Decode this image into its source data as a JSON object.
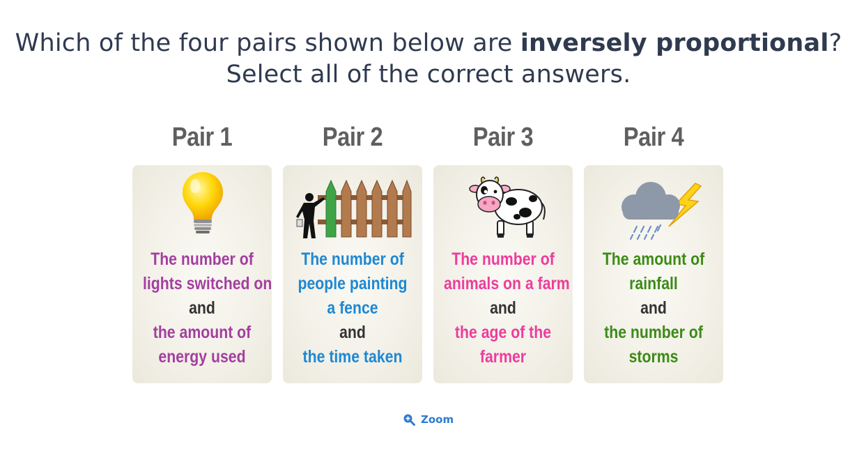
{
  "question": {
    "line1_before": "Which of the four pairs shown below are ",
    "line1_bold": "inversely proportional",
    "line1_after": "?",
    "line2": "Select all of the correct answers."
  },
  "pairs": [
    {
      "title": "Pair 1",
      "icon": "light-bulb-icon",
      "color": "#a43ea0",
      "first_lines": [
        "The number of",
        "lights switched on"
      ],
      "and": "and",
      "second_lines": [
        "the amount of",
        "energy used"
      ]
    },
    {
      "title": "Pair 2",
      "icon": "fence-painter-icon",
      "color": "#1e88d3",
      "first_lines": [
        "The number of",
        "people painting",
        "a fence"
      ],
      "and": "and",
      "second_lines": [
        "the time taken"
      ]
    },
    {
      "title": "Pair 3",
      "icon": "cow-icon",
      "color": "#ee3c9c",
      "first_lines": [
        "The number of",
        "animals on a farm"
      ],
      "and": "and",
      "second_lines": [
        "the age of the",
        "farmer"
      ]
    },
    {
      "title": "Pair 4",
      "icon": "storm-cloud-icon",
      "color": "#3c8b16",
      "first_lines": [
        "The amount of",
        "rainfall"
      ],
      "and": "and",
      "second_lines": [
        "the number of",
        "storms"
      ]
    }
  ],
  "zoom": {
    "label": "Zoom",
    "icon": "zoom-in-icon",
    "color": "#2f7ad0"
  }
}
